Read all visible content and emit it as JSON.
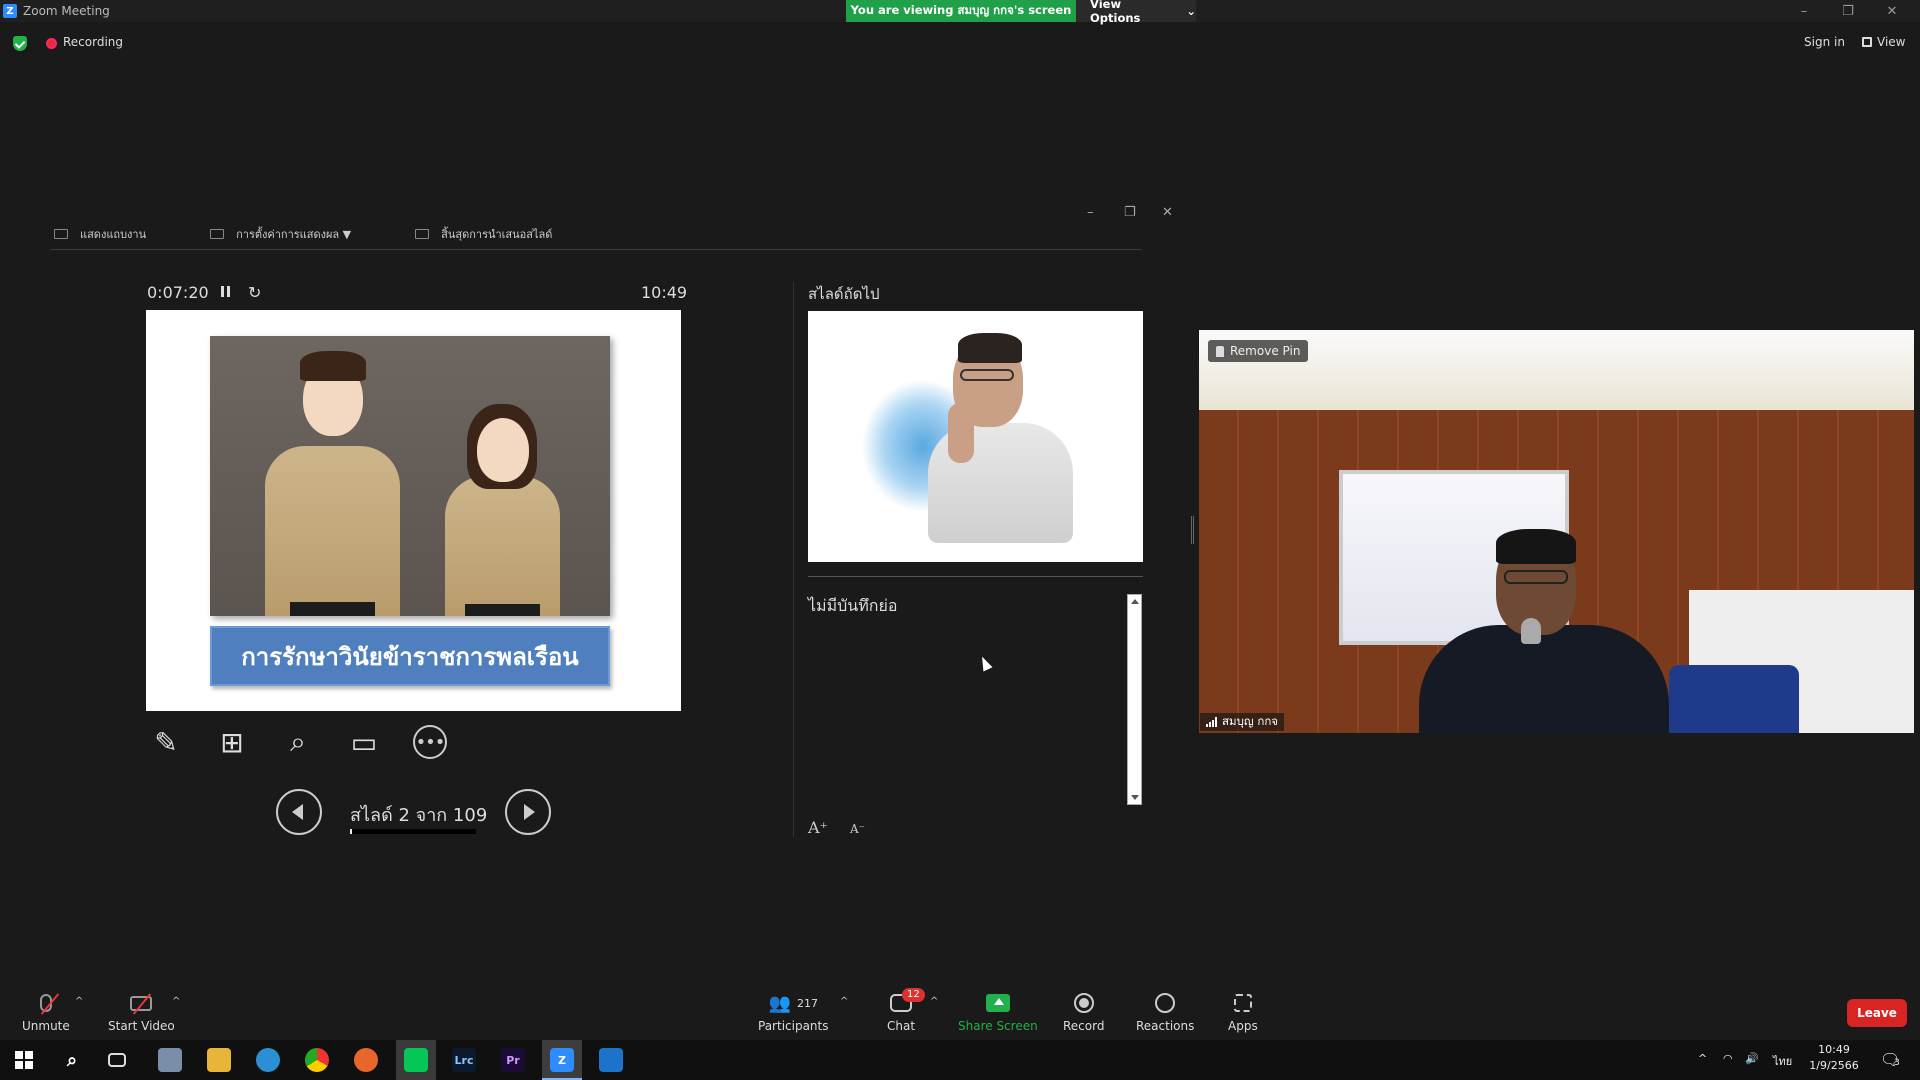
{
  "window": {
    "app_title": "Zoom Meeting",
    "viewing_banner": "You are viewing สมบุญ กกจ's screen",
    "view_options": "View Options",
    "controls": [
      "–",
      "❐",
      "✕"
    ]
  },
  "status": {
    "recording_label": "Recording",
    "sign_in": "Sign in",
    "view_label": "View"
  },
  "presenter": {
    "toolbar": {
      "show_taskbar": "แสดงแถบงาน",
      "display_settings": "การตั้งค่าการแสดงผล ▼",
      "end_slideshow": "สิ้นสุดการนำเสนอสไลด์"
    },
    "window_controls": [
      "–",
      "❐",
      "✕"
    ],
    "timer": "0:07:20",
    "clock": "10:49",
    "current_slide_title": "การรักษาวินัยข้าราชการพลเรือน",
    "slide_counter": "สไลด์ 2 จาก 109",
    "slide_progress": 0.018,
    "next_slide_label": "สไลด์ถัดไป",
    "notes_text": "ไม่มีบันทึกย่อ",
    "font_up": "A⁺",
    "font_down": "A⁻",
    "tools": [
      "pen-icon",
      "slides-grid-icon",
      "zoom-icon",
      "black-screen-icon",
      "more-icon"
    ]
  },
  "video": {
    "remove_pin": "Remove Pin",
    "participant_name": "สมบุญ กกจ"
  },
  "controls": {
    "unmute": "Unmute",
    "start_video": "Start Video",
    "participants": "Participants",
    "participant_count": "217",
    "chat": "Chat",
    "chat_badge": "12",
    "share_screen": "Share Screen",
    "record": "Record",
    "reactions": "Reactions",
    "apps": "Apps",
    "leave": "Leave",
    "share_color": "#22b04b",
    "leave_color": "#d92424"
  },
  "taskbar": {
    "apps": [
      "start-icon",
      "search-icon",
      "task-view-icon",
      "explorer-icon",
      "folder-icon",
      "edge-icon",
      "chrome-icon",
      "firefox-icon",
      "line-icon",
      "lightroom-icon",
      "premiere-icon",
      "zoom-icon",
      "photos-icon"
    ],
    "lrc_label": "Lrc",
    "pr_label": "Pr",
    "lang": "ไทย",
    "time": "10:49",
    "date": "1/9/2566",
    "notif_count": "3"
  }
}
